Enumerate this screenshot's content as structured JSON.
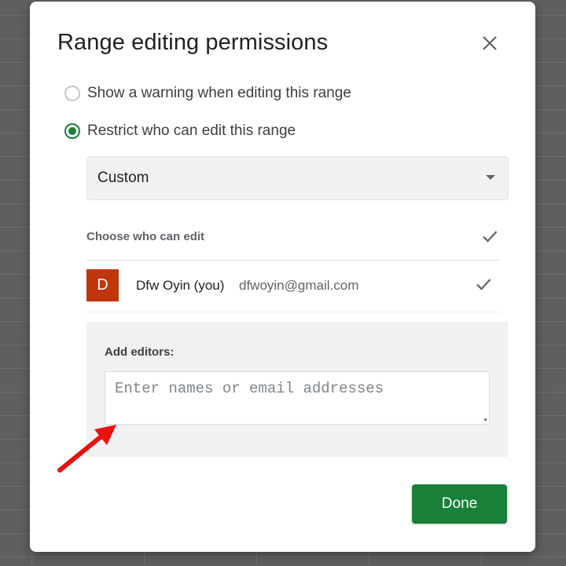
{
  "dialog": {
    "title": "Range editing permissions"
  },
  "options": [
    {
      "label": "Show a warning when editing this range",
      "selected": false
    },
    {
      "label": "Restrict who can edit this range",
      "selected": true
    }
  ],
  "dropdown": {
    "selected": "Custom"
  },
  "editors_list": {
    "header": "Choose who can edit",
    "users": [
      {
        "initial": "D",
        "name": "Dfw Oyin (you)",
        "email": "dfwoyin@gmail.com",
        "checked": true
      }
    ]
  },
  "add_editors": {
    "label": "Add editors:",
    "placeholder": "Enter names or email addresses",
    "value": ""
  },
  "actions": {
    "done_label": "Done"
  },
  "colors": {
    "accent": "#188038",
    "avatar": "#bf360c",
    "annotation_arrow": "#e8130f"
  },
  "icons": {
    "close": "close-icon",
    "dropdown": "chevron-down-icon",
    "check": "check-icon"
  }
}
